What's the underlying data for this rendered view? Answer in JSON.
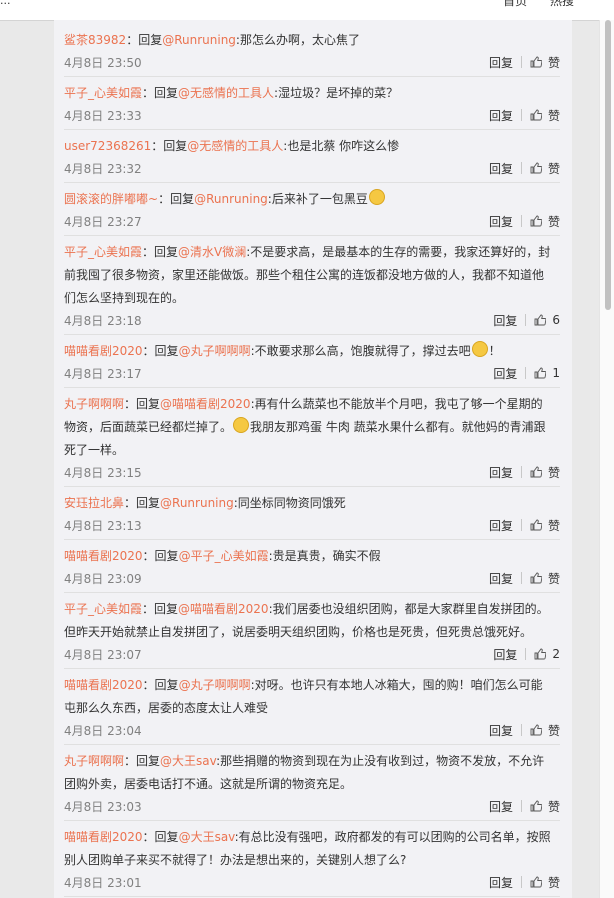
{
  "topbar": {
    "left_text": "...",
    "home": "首页",
    "hot": "热搜"
  },
  "reply_label": "回复",
  "like_label": "赞",
  "comments": [
    {
      "user": "鲨茶83982",
      "prefix": "：回复",
      "at": "@Runruning",
      "text": ":那怎么办啊，太心焦了",
      "time": "4月8日 23:50",
      "likes": ""
    },
    {
      "user": "平子_心美如霞",
      "prefix": "：回复",
      "at": "@无感情的工具人",
      "text": ":湿垃圾？是坏掉的菜？",
      "time": "4月8日 23:33",
      "likes": ""
    },
    {
      "user": "user72368261",
      "prefix": "：回复",
      "at": "@无感情的工具人",
      "text": ":也是北蔡 你咋这么惨",
      "time": "4月8日 23:32",
      "likes": ""
    },
    {
      "user": "圆滚滚的胖嘟嘟~",
      "prefix": "：回复",
      "at": "@Runruning",
      "text": ":后来补了一包黑豆",
      "time": "4月8日 23:27",
      "likes": "",
      "emoji_end": true
    },
    {
      "user": "平子_心美如霞",
      "prefix": "：回复",
      "at": "@清水V微澜",
      "text": ":不是要求高，是最基本的生存的需要，我家还算好的，封前我囤了很多物资，家里还能做饭。那些个租住公寓的连饭都没地方做的人，我都不知道他们怎么坚持到现在的。",
      "time": "4月8日 23:18",
      "likes": "6"
    },
    {
      "user": "喵喵看剧2020",
      "prefix": "：回复",
      "at": "@丸子啊啊啊",
      "text": ":不敢要求那么高，饱腹就得了，撑过去吧",
      "text2": "！",
      "time": "4月8日 23:17",
      "likes": "1",
      "emoji_mid": true
    },
    {
      "user": "丸子啊啊啊",
      "prefix": "：回复",
      "at": "@喵喵看剧2020",
      "text": ":再有什么蔬菜也不能放半个月吧，我屯了够一个星期的物资，后面蔬菜已经都烂掉了。",
      "text2": "我朋友那鸡蛋 牛肉 蔬菜水果什么都有。就他妈的青浦跟死了一样。",
      "time": "4月8日 23:15",
      "likes": "",
      "emoji_mid": true
    },
    {
      "user": "安珏拉北鼻",
      "prefix": "：回复",
      "at": "@Runruning",
      "text": ":同坐标同物资同饿死",
      "time": "4月8日 23:13",
      "likes": ""
    },
    {
      "user": "喵喵看剧2020",
      "prefix": "：回复",
      "at": "@平子_心美如霞",
      "text": ":贵是真贵，确实不假",
      "time": "4月8日 23:09",
      "likes": ""
    },
    {
      "user": "平子_心美如霞",
      "prefix": "：回复",
      "at": "@喵喵看剧2020",
      "text": ":我们居委也没组织团购，都是大家群里自发拼团的。但昨天开始就禁止自发拼团了，说居委明天组织团购，价格也是死贵，但死贵总饿死好。",
      "time": "4月8日 23:07",
      "likes": "2"
    },
    {
      "user": "喵喵看剧2020",
      "prefix": "：回复",
      "at": "@丸子啊啊啊",
      "text": ":对呀。也许只有本地人冰箱大，囤的购！咱们怎么可能屯那么久东西，居委的态度太让人难受",
      "time": "4月8日 23:04",
      "likes": ""
    },
    {
      "user": "丸子啊啊啊",
      "prefix": "：回复",
      "at": "@大王sav",
      "text": ":那些捐赠的物资到现在为止没有收到过，物资不发放，不允许团购外卖，居委电话打不通。这就是所谓的物资充足。",
      "time": "4月8日 23:03",
      "likes": ""
    },
    {
      "user": "喵喵看剧2020",
      "prefix": "：回复",
      "at": "@大王sav",
      "text": ":有总比没有强吧，政府都发的有可以团购的公司名单，按照别人团购单子来买不就得了！办法是想出来的，关键别人想了么?",
      "time": "4月8日 23:01",
      "likes": ""
    }
  ]
}
